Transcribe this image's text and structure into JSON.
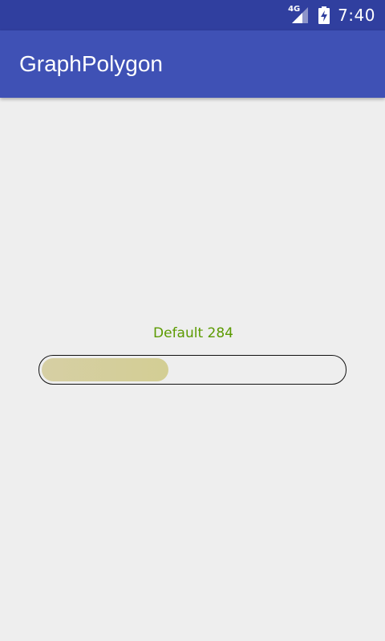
{
  "status_bar": {
    "network_type": "4G",
    "time": "7:40",
    "background": "#303f9f"
  },
  "app_bar": {
    "title": "GraphPolygon",
    "background": "#3f51b5"
  },
  "progress": {
    "label": "Default 284",
    "fraction": 0.42,
    "label_color": "#5b9a00",
    "fill_colors": [
      "#d6cfa4",
      "#d3ce94"
    ],
    "border_color": "#111111"
  }
}
